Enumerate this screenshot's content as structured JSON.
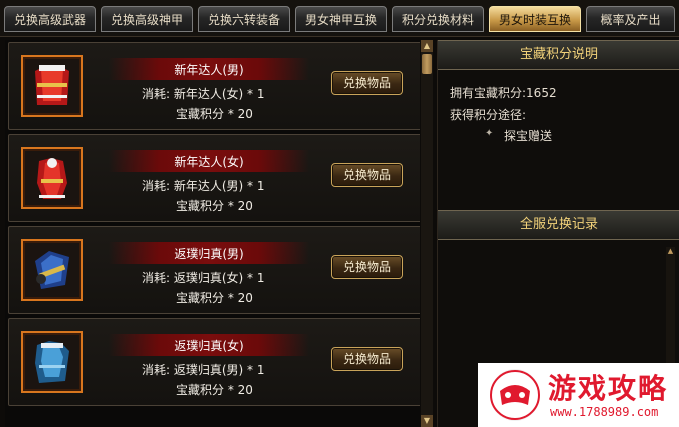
{
  "tabs": [
    {
      "label": "兑换高级武器",
      "active": false
    },
    {
      "label": "兑换高级神甲",
      "active": false
    },
    {
      "label": "兑换六转装备",
      "active": false
    },
    {
      "label": "男女神甲互换",
      "active": false
    },
    {
      "label": "积分兑换材料",
      "active": false
    },
    {
      "label": "男女时装互换",
      "active": true
    },
    {
      "label": "概率及产出",
      "active": false
    }
  ],
  "items": [
    {
      "name": "新年达人(男)",
      "cost_line": "消耗:  新年达人(女) * 1",
      "points_line": "宝藏积分 * 20",
      "button": "兑换物品",
      "icon": "red-robe-icon"
    },
    {
      "name": "新年达人(女)",
      "cost_line": "消耗:  新年达人(男) * 1",
      "points_line": "宝藏积分 * 20",
      "button": "兑换物品",
      "icon": "red-dress-icon"
    },
    {
      "name": "返璞归真(男)",
      "cost_line": "消耗:  返璞归真(女) * 1",
      "points_line": "宝藏积分 * 20",
      "button": "兑换物品",
      "icon": "blue-robe-icon"
    },
    {
      "name": "返璞归真(女)",
      "cost_line": "消耗:  返璞归真(男) * 1",
      "points_line": "宝藏积分 * 20",
      "button": "兑换物品",
      "icon": "blue-dress-icon"
    }
  ],
  "info": {
    "title": "宝藏积分说明",
    "points_line": "拥有宝藏积分:1652",
    "ways_label": "获得积分途径:",
    "way_item": "探宝赠送"
  },
  "records": {
    "title": "全服兑换记录"
  },
  "watermark": {
    "title": "游戏攻略",
    "url": "www.1788989.com"
  },
  "colors": {
    "accent_gold": "#f2d27a",
    "slot_border": "#d8761e",
    "name_bar": "#7a0d0d",
    "watermark_red": "#e0192e"
  }
}
